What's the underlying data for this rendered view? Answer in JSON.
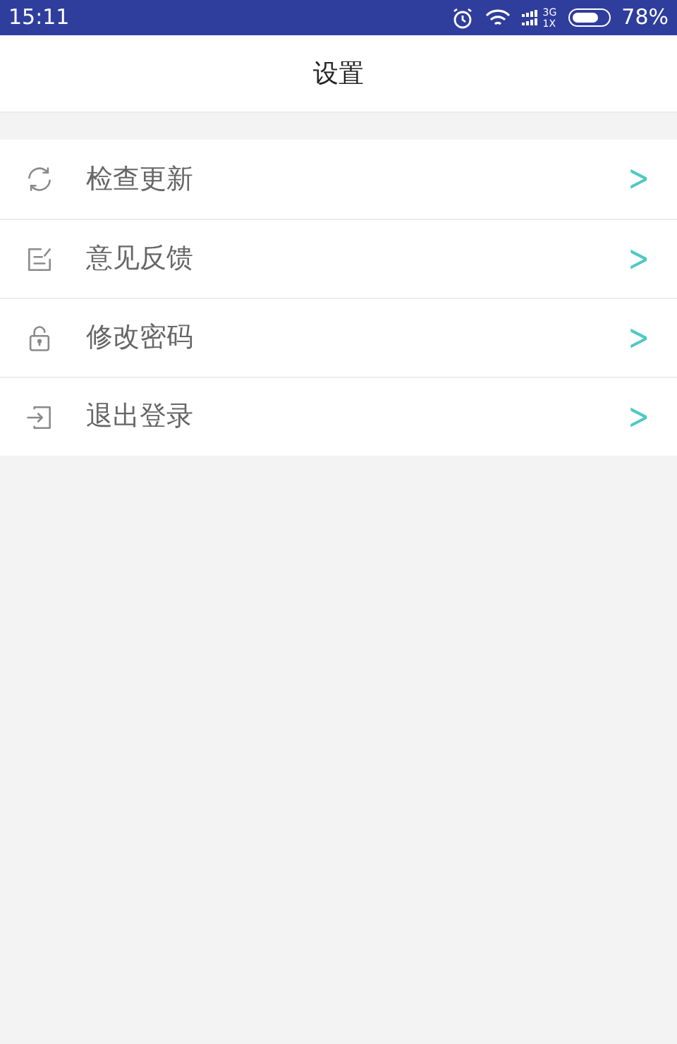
{
  "status_bar": {
    "time": "15:11",
    "network_top": "3G",
    "network_bottom": "1X",
    "battery": "78%"
  },
  "header": {
    "title": "设置"
  },
  "menu": [
    {
      "kind": "refresh",
      "label": "检查更新",
      "chevron": ">"
    },
    {
      "kind": "feedback",
      "label": "意见反馈",
      "chevron": ">"
    },
    {
      "kind": "lock",
      "label": "修改密码",
      "chevron": ">"
    },
    {
      "kind": "logout",
      "label": "退出登录",
      "chevron": ">"
    }
  ]
}
